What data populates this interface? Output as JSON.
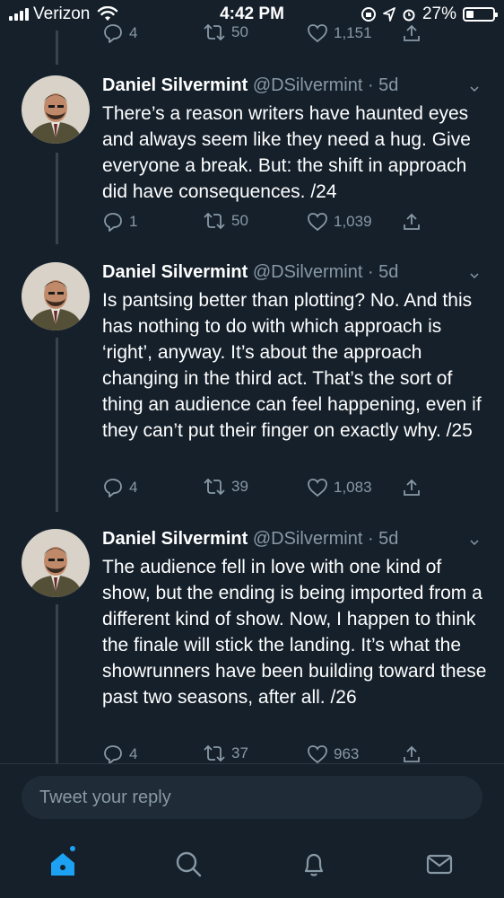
{
  "status_bar": {
    "carrier": "Verizon",
    "time": "4:42 PM",
    "battery": "27%",
    "battery_level": 0.27
  },
  "top_actions": {
    "replies": "4",
    "retweets": "50",
    "likes": "1,151"
  },
  "tweets": [
    {
      "name": "Daniel Silvermint",
      "handle": "@DSilvermint",
      "age": "5d",
      "text": "There’s a reason writers have haunted eyes and always seem like they need a hug. Give everyone a break. But: the shift in approach did have consequences.  /24",
      "replies": "1",
      "retweets": "50",
      "likes": "1,039"
    },
    {
      "name": "Daniel Silvermint",
      "handle": "@DSilvermint",
      "age": "5d",
      "text": "Is pantsing better than plotting? No. And this has nothing to do with which approach is ‘right’, anyway. It’s about the approach changing in the third act. That’s the sort of thing an audience can feel happening, even if they can’t put their finger on exactly why.  /25",
      "replies": "4",
      "retweets": "39",
      "likes": "1,083"
    },
    {
      "name": "Daniel Silvermint",
      "handle": "@DSilvermint",
      "age": "5d",
      "text": "The audience fell in love with one kind of show, but the ending is being imported from a different kind of show. Now, I happen to think the finale will stick the landing. It’s what the showrunners have been building toward these past two seasons, after all.  /26",
      "replies": "4",
      "retweets": "37",
      "likes": "963"
    }
  ],
  "reply": {
    "placeholder": "Tweet your reply"
  },
  "tabbar": {
    "icons": [
      "home-icon",
      "search-icon",
      "notifications-icon",
      "messages-icon"
    ]
  },
  "colors": {
    "background": "#15202b",
    "secondary_text": "#8899a6",
    "accent": "#1da1f2",
    "line": "#38444d"
  }
}
